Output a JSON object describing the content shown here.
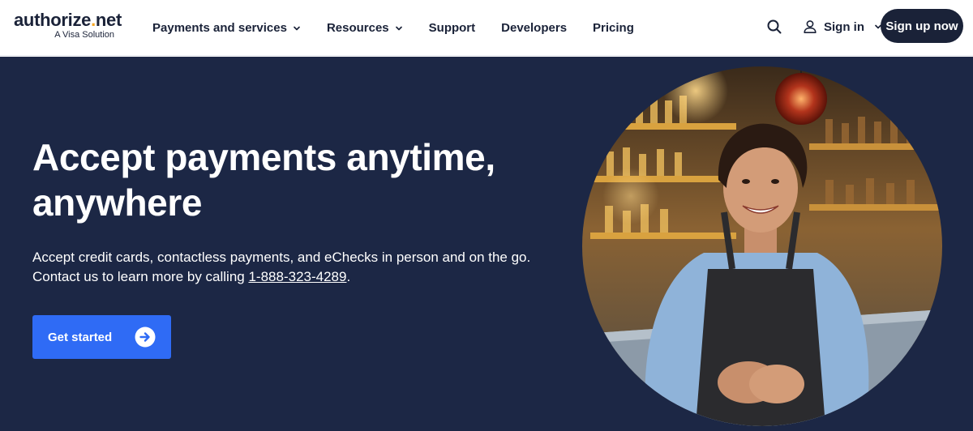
{
  "brand": {
    "name": "authorize",
    "dot": ".",
    "tld": "net",
    "tagline": "A Visa Solution"
  },
  "nav": {
    "items": [
      {
        "label": "Payments and services",
        "has_dropdown": true
      },
      {
        "label": "Resources",
        "has_dropdown": true
      },
      {
        "label": "Support",
        "has_dropdown": false
      },
      {
        "label": "Developers",
        "has_dropdown": false
      },
      {
        "label": "Pricing",
        "has_dropdown": false
      }
    ],
    "search_icon": "search-icon",
    "signin_label": "Sign in",
    "signup_label": "Sign up now"
  },
  "hero": {
    "title_line1": "Accept payments anytime,",
    "title_line2": "anywhere",
    "description_pre": "Accept credit cards, contactless payments, and eChecks in person and on the go. Contact us to learn more by calling ",
    "phone": "1-888-323-4289",
    "description_post": ".",
    "cta_label": "Get started",
    "cta_icon": "arrow-right-circle-icon"
  },
  "colors": {
    "navy": "#1c2745",
    "header_text": "#1a2238",
    "accent_blue": "#2f6bf5",
    "logo_dot": "#f5a623",
    "signup_bg": "#1a2238"
  }
}
